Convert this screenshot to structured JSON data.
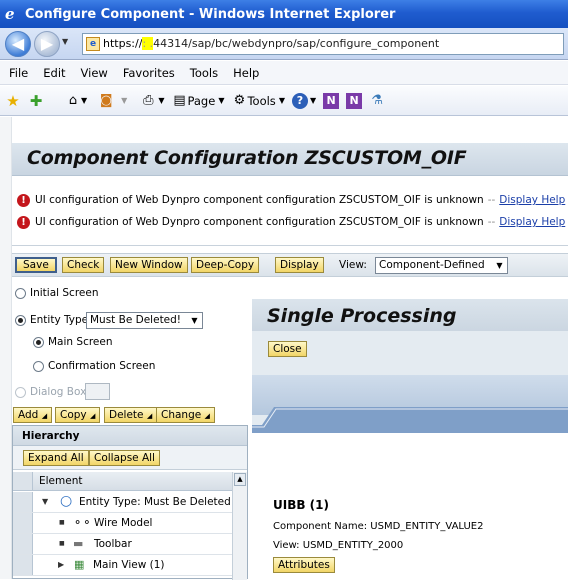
{
  "window": {
    "title": "Configure Component - Windows Internet Explorer"
  },
  "address": {
    "scheme": "https://",
    "redacted": ":                 .",
    "rest": "44314/sap/bc/webdynpro/sap/configure_component"
  },
  "menu": [
    "File",
    "Edit",
    "View",
    "Favorites",
    "Tools",
    "Help"
  ],
  "toolbar": {
    "page_label": "Page",
    "tools_label": "Tools"
  },
  "page": {
    "title": "Component Configuration ZSCUSTOM_OIF"
  },
  "messages": [
    {
      "text": "UI configuration of Web Dynpro component configuration ZSCUSTOM_OIF is unknown",
      "sep": "--",
      "link": "Display Help"
    },
    {
      "text": "UI configuration of Web Dynpro component configuration ZSCUSTOM_OIF is unknown",
      "sep": "--",
      "link": "Display Help"
    }
  ],
  "buttons": {
    "save": "Save",
    "check": "Check",
    "new_window": "New Window",
    "deep_copy": "Deep-Copy",
    "display": "Display"
  },
  "view": {
    "label": "View:",
    "value": "Component-Defined"
  },
  "left": {
    "initial_screen": "Initial Screen",
    "entity_type": "Entity Type",
    "entity_type_value": "Must Be Deleted!",
    "main_screen": "Main Screen",
    "confirmation_screen": "Confirmation Screen",
    "dialog_box": "Dialog Box",
    "add": "Add",
    "copy": "Copy",
    "delete": "Delete",
    "change": "Change"
  },
  "hierarchy": {
    "title": "Hierarchy",
    "expand_all": "Expand All",
    "collapse_all": "Collapse All",
    "column": "Element",
    "rows": [
      {
        "label": "Entity Type: Must Be Deleted!",
        "icon": "circle-icon"
      },
      {
        "label": "Wire Model",
        "icon": "wire-model-icon"
      },
      {
        "label": "Toolbar",
        "icon": "toolbar-icon"
      },
      {
        "label": "Main View (1)",
        "icon": "view-icon"
      }
    ]
  },
  "right": {
    "title": "Single Processing",
    "close": "Close",
    "uibb_title": "UIBB (1)",
    "component_label": "Component Name:",
    "component_value": "USMD_ENTITY_VALUE2",
    "view_label": "View:",
    "view_value": "USMD_ENTITY_2000",
    "attributes": "Attributes"
  },
  "colors": {
    "button_yellow": "#f2d566",
    "error_red": "#c4161c",
    "title_blue": "#1f5ccf"
  }
}
